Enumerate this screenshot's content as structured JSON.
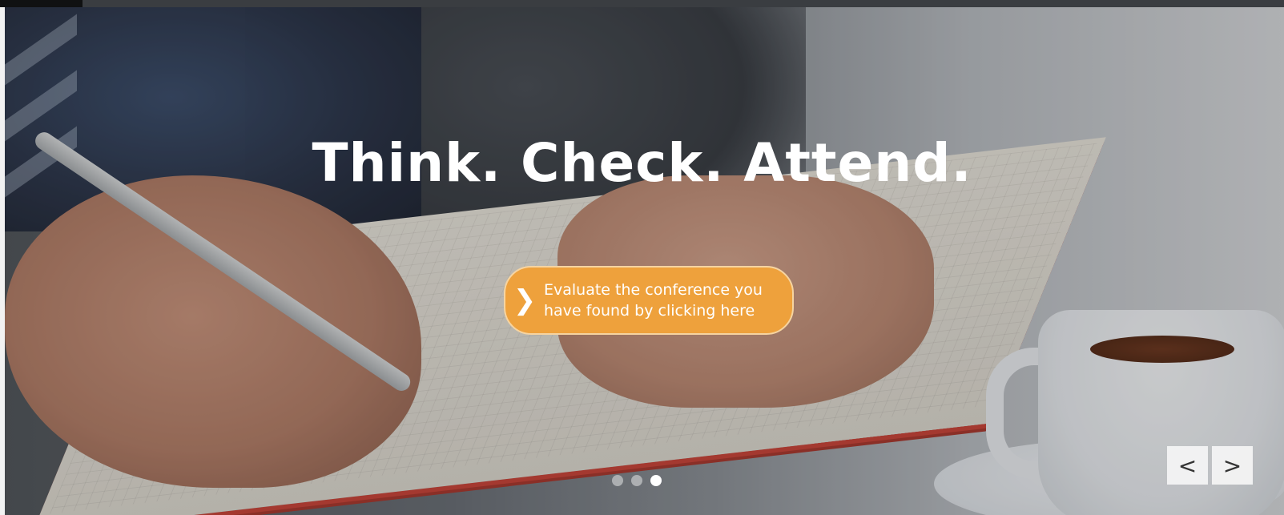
{
  "hero": {
    "headline": "Think. Check. Attend.",
    "cta_text": "Evaluate the conference you\nhave found by clicking here",
    "cta_color": "#eea13c",
    "cta_icon": "chevron-right-icon"
  },
  "slider": {
    "total_slides": 3,
    "active_slide": 3,
    "prev_label": "<",
    "next_label": ">"
  }
}
